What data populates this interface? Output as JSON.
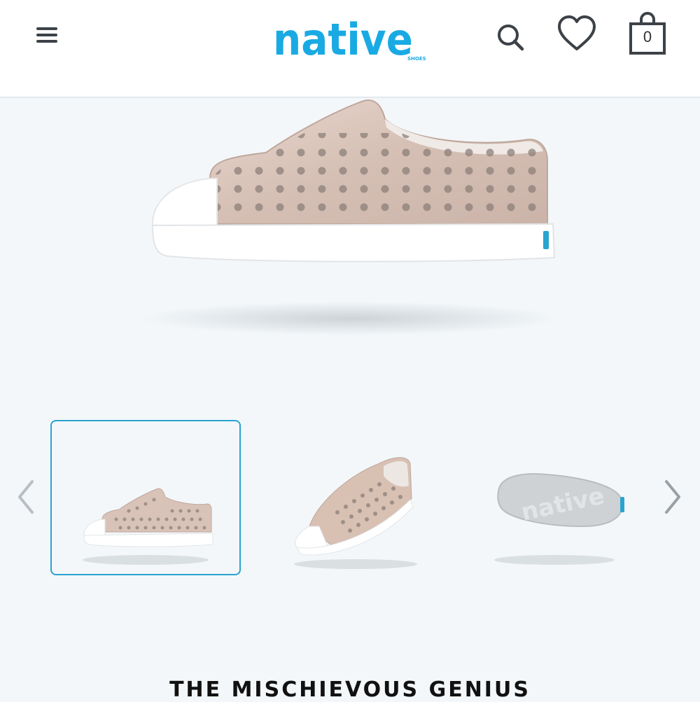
{
  "header": {
    "logo_text": "native",
    "logo_sub": "SHOES",
    "bag_count": "0",
    "brand_color": "#1aaae3",
    "icons": [
      "menu-icon",
      "search-icon",
      "heart-icon",
      "bag-icon"
    ]
  },
  "gallery": {
    "thumbnails": [
      {
        "view": "side",
        "active": true
      },
      {
        "view": "angled",
        "active": false
      },
      {
        "view": "sole",
        "active": false
      }
    ],
    "arrows": [
      "chevron-left-icon",
      "chevron-right-icon"
    ]
  },
  "product": {
    "title": "THE MISCHIEVOUS GENIUS"
  },
  "colors": {
    "accent": "#2aa3cf",
    "background": "#f3f7fa",
    "shoe_glitter": "#d8c2b8"
  }
}
